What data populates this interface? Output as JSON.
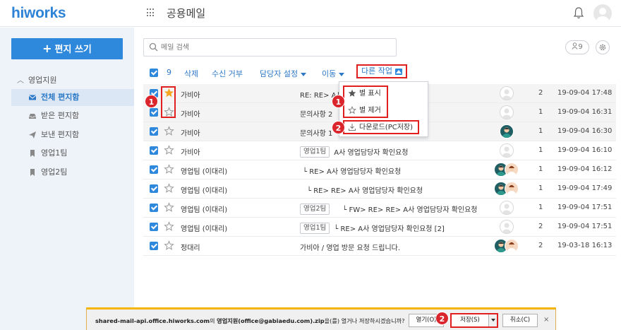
{
  "header": {
    "logo": "hiworks",
    "app_title": "공용메일"
  },
  "sidebar": {
    "compose_label": "편지 쓰기",
    "group_label": "영업지원",
    "folders": [
      {
        "label": "전체 편지함",
        "icon": "envelope-icon",
        "active": true
      },
      {
        "label": "받은 편지함",
        "icon": "inbox-icon",
        "active": false
      },
      {
        "label": "보낸 편지함",
        "icon": "paper-plane-icon",
        "active": false
      },
      {
        "label": "영업1팀",
        "icon": "bookmark-icon",
        "active": false
      },
      {
        "label": "영업2팀",
        "icon": "bookmark-icon",
        "active": false
      }
    ]
  },
  "search": {
    "placeholder": "메일 검색"
  },
  "top_right": {
    "people_count": "9"
  },
  "toolbar": {
    "selected_count": "9",
    "delete": "삭제",
    "block": "수신 거부",
    "assignee": "담당자 설정",
    "move": "이동",
    "other": "다른 작업"
  },
  "dropdown": {
    "star_add": "별 표시",
    "star_remove": "별 제거",
    "download": "다운로드(PC저장)"
  },
  "mails": [
    {
      "sender": "가비아",
      "tag": "",
      "subject": "RE: RE> A사",
      "count": "2",
      "date": "19-09-04 17:48",
      "starred": true
    },
    {
      "sender": "가비아",
      "tag": "",
      "subject": "문의사항 2",
      "count": "1",
      "date": "19-09-04 16:31",
      "starred": false
    },
    {
      "sender": "가비아",
      "tag": "",
      "subject": "문의사항 1",
      "count": "1",
      "date": "19-09-04 16:30",
      "starred": false
    },
    {
      "sender": "가비아",
      "tag": "영업1팀",
      "subject": "A사 영업담당자 확인요청",
      "count": "1",
      "date": "19-09-04 16:10",
      "starred": false
    },
    {
      "sender": "영업팀 (이대리)",
      "tag": "",
      "subject": "└ RE> A사 영업담당자 확인요청",
      "count": "1",
      "date": "19-09-04 16:12",
      "starred": false
    },
    {
      "sender": "영업팀 (이대리)",
      "tag": "",
      "subject": "└ RE> RE> A사 영업담당자 확인요청",
      "count": "1",
      "date": "19-09-04 17:49",
      "starred": false
    },
    {
      "sender": "영업팀 (이대리)",
      "tag": "영업2팀",
      "subject": "└ FW> RE> RE> A사 영업담당자 확인요청",
      "count": "1",
      "date": "19-09-04 17:51",
      "starred": false
    },
    {
      "sender": "영업팀 (이대리)",
      "tag": "영업1팀",
      "subject": "└ RE> A사 영업담당자 확인요청 [2]",
      "count": "2",
      "date": "19-09-04 17:51",
      "starred": false
    },
    {
      "sender": "정대리",
      "tag": "",
      "subject": "가비아 / 영업 방문 요청 드립니다.",
      "count": "2",
      "date": "19-03-18 16:13",
      "starred": false
    }
  ],
  "badges": [
    "1",
    "1",
    "2",
    "2"
  ],
  "download_bar": {
    "host": "shared-mail-api.office.hiworks.com",
    "mid": "의 ",
    "filename": "영업지원(office@gabiaedu.com).zip",
    "suffix": "을(를) 열거나 저장하시겠습니까?",
    "open": "열기(O)",
    "save": "저장(S)",
    "cancel": "취소(C)",
    "close": "×"
  },
  "colors": {
    "brand": "#2d83d6",
    "highlight": "#e02020",
    "star": "#f5a623"
  }
}
